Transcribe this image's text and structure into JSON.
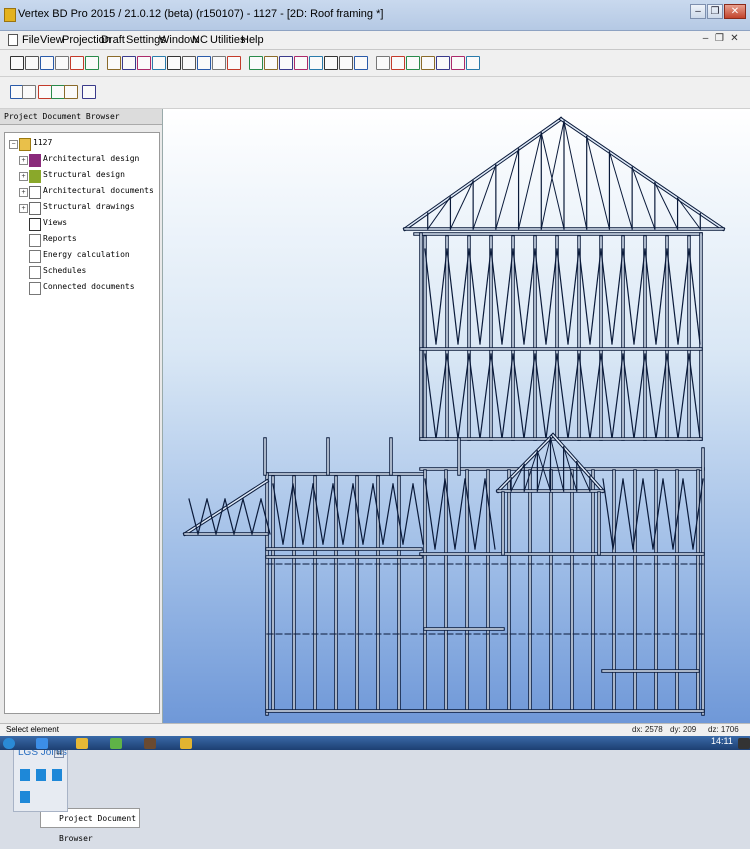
{
  "window": {
    "title": "Vertex BD Pro 2015 / 21.0.12 (beta) (r150107) - 1127 - [2D: Roof framing *]",
    "minimize": "–",
    "restore": "❐",
    "close": "✕"
  },
  "menu": {
    "items": [
      "File",
      "View",
      "Projection",
      "Draft",
      "Settings",
      "Window",
      "NC",
      "Utilities",
      "Help"
    ],
    "mdi_minimize": "–",
    "mdi_restore": "❐",
    "mdi_close": "✕"
  },
  "toolbar1": {
    "icons": [
      "new-icon",
      "open-icon",
      "save-icon",
      "print-icon",
      "export-icon",
      "layers-icon",
      "pencil-icon",
      "erase-icon",
      "stud-icon",
      "panel-icon",
      "grid-icon",
      "cube-icon",
      "select-icon",
      "align-icon",
      "color-icon",
      "line-icon",
      "polyline-icon",
      "hatch-icon",
      "frame-icon",
      "dimension-icon",
      "text-icon",
      "table-icon",
      "block-icon",
      "label-icon",
      "symbol-icon",
      "view3d-icon",
      "tree-icon",
      "house-icon",
      "terrain-icon",
      "roof-icon"
    ]
  },
  "toolbar2": {
    "icons": [
      "pointer-icon",
      "snap-icon",
      "zoom-icon",
      "zoom-window-icon",
      "pan-icon",
      "refresh-icon"
    ]
  },
  "panel": {
    "title": "Project Document Browser",
    "tree": {
      "root": "1127",
      "items": [
        {
          "label": "Architectural design",
          "icon": "architectural-design-icon"
        },
        {
          "label": "Structural design",
          "icon": "structural-design-icon"
        },
        {
          "label": "Architectural documents",
          "icon": "documents-icon"
        },
        {
          "label": "Structural drawings",
          "icon": "drawings-icon"
        },
        {
          "label": "Views",
          "icon": "views-icon"
        },
        {
          "label": "Reports",
          "icon": "reports-icon"
        },
        {
          "label": "Energy calculation",
          "icon": "energy-icon"
        },
        {
          "label": "Schedules",
          "icon": "schedules-icon"
        },
        {
          "label": "Connected documents",
          "icon": "connected-documents-icon"
        }
      ]
    },
    "tab_label": "Project Document Browser"
  },
  "joints": {
    "title": "LGS Joints",
    "pin": "⊡"
  },
  "status": {
    "message": "Select element",
    "dx": "dx: 2578",
    "dy": "dy: 209",
    "dz": "dz: 1706"
  },
  "taskbar": {
    "clock": "14:11"
  },
  "colors": {
    "frame_dark": "#0a1a3a",
    "frame_light": "#dfeaf8",
    "viewport_top": "#ffffff",
    "viewport_bottom": "#6f98d8",
    "accent": "#1e88d8"
  }
}
